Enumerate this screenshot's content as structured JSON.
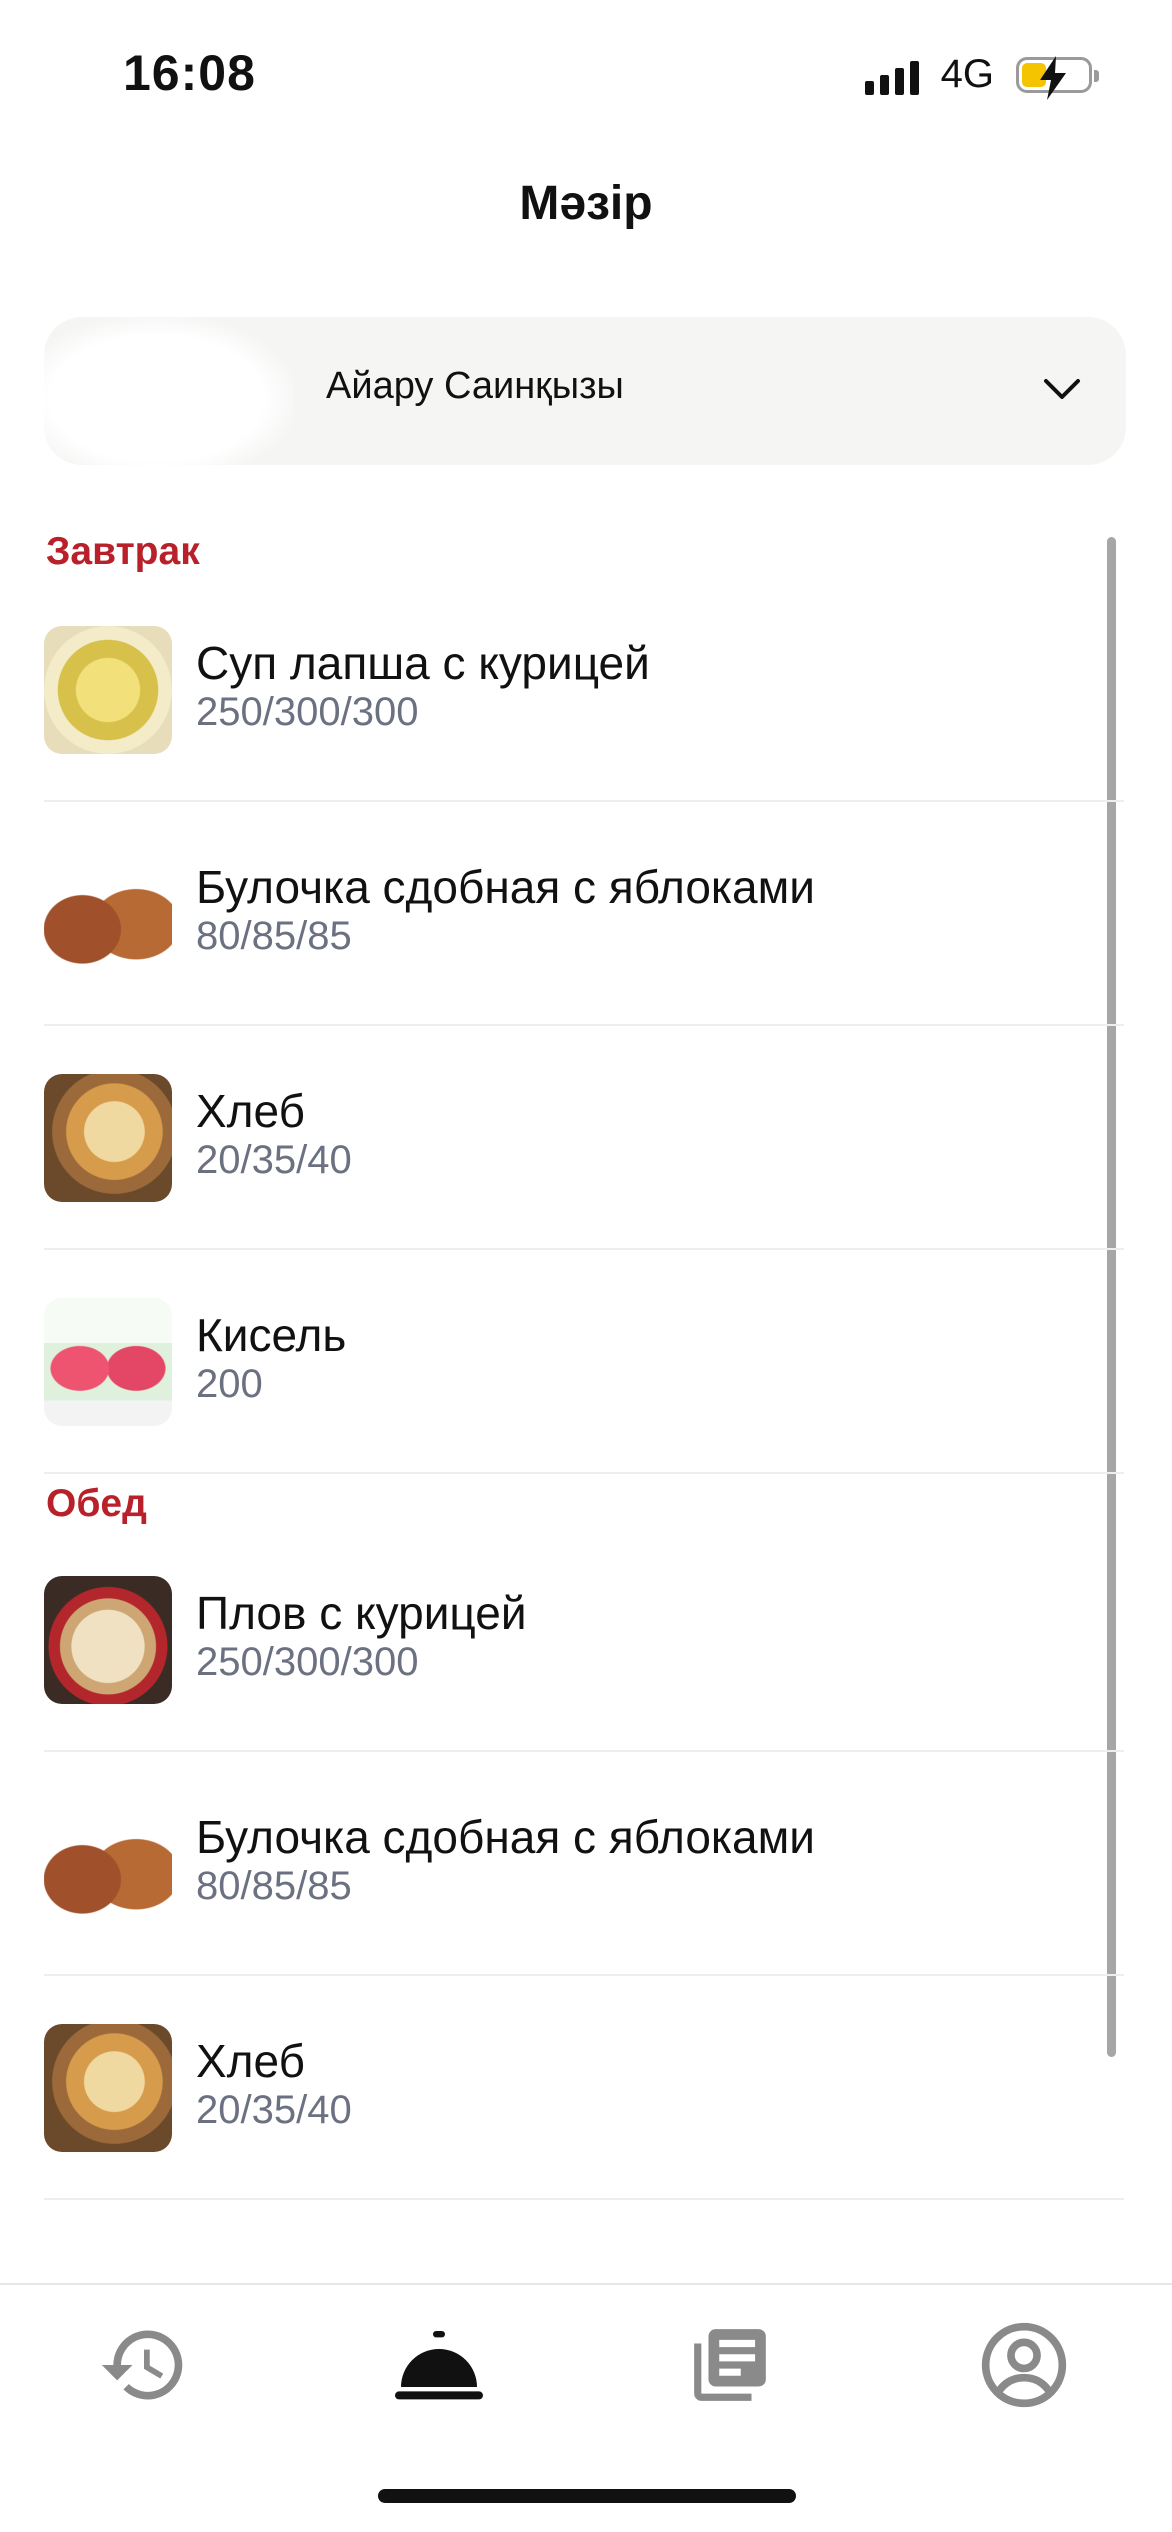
{
  "status_bar": {
    "time": "16:08",
    "network": "4G"
  },
  "header": {
    "title": "Мәзір"
  },
  "selector": {
    "value": "Айару Саинқызы"
  },
  "sections": [
    {
      "title": "Завтрак"
    },
    {
      "title": "Обед"
    }
  ],
  "items": [
    {
      "name": "Суп лапша с курицей",
      "portion": "250/300/300",
      "icon": "noodle-soup-photo"
    },
    {
      "name": "Булочка сдобная с яблоками",
      "portion": "80/85/85",
      "icon": "apple-bun-photo"
    },
    {
      "name": "Хлеб",
      "portion": "20/35/40",
      "icon": "bread-photo"
    },
    {
      "name": "Кисель",
      "portion": "200",
      "icon": "kissel-photo"
    },
    {
      "name": "Плов с курицей",
      "portion": "250/300/300",
      "icon": "plov-photo"
    },
    {
      "name": "Булочка сдобная с яблоками",
      "portion": "80/85/85",
      "icon": "apple-bun-photo"
    },
    {
      "name": "Хлеб",
      "portion": "20/35/40",
      "icon": "bread-photo"
    }
  ],
  "tabs": [
    {
      "icon": "history-icon",
      "active": false
    },
    {
      "icon": "menu-cloche-icon",
      "active": true
    },
    {
      "icon": "documents-icon",
      "active": false
    },
    {
      "icon": "profile-icon",
      "active": false
    }
  ],
  "colors": {
    "section_title": "#b8202a",
    "portion_text": "#6c7182",
    "active_tab": "#111111",
    "inactive_tab": "#8a8a8a"
  }
}
